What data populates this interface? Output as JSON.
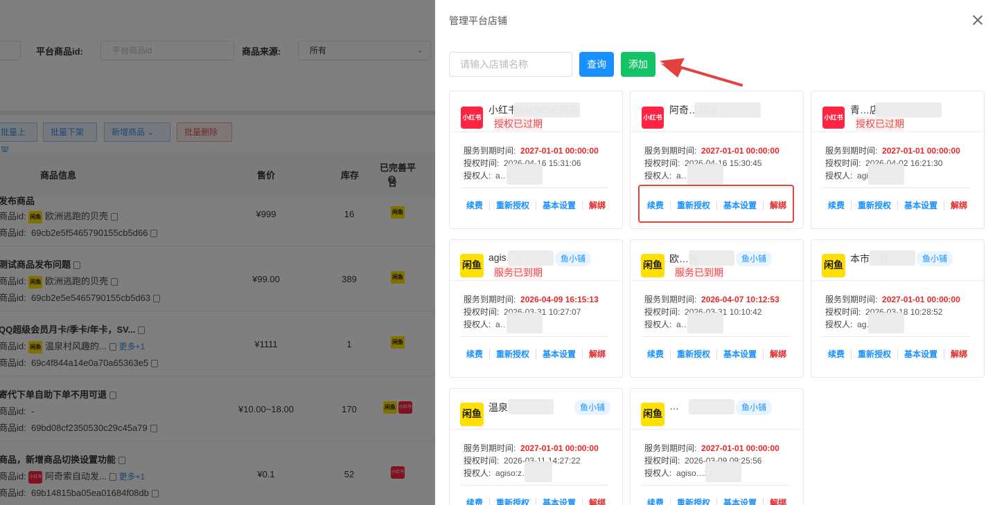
{
  "background": {
    "filters": {
      "platform_item_id_label": "平台商品id:",
      "platform_item_id_placeholder": "平台商品id",
      "source_label": "商品来源:",
      "source_value": "所有"
    },
    "bulk_buttons": [
      "批量上架",
      "批量下架",
      "新增商品",
      "批量删除"
    ],
    "columns": {
      "info": "商品信息",
      "price": "售价",
      "stock": "库存",
      "done": "已完善平",
      "done2": "台"
    },
    "rows": [
      {
        "title": "发布商品",
        "shop": "欧洲逃跑的贝壳",
        "item_id": "69cb2e5f5465790155cb5d66",
        "price": "¥999",
        "stock": "16"
      },
      {
        "title": "测试商品发布问题",
        "shop": "欧洲逃跑的贝壳",
        "item_id": "69cb2e5e5465790155cb5d63",
        "price": "¥99.00",
        "stock": "389"
      },
      {
        "title": "QQ超级会员月卡/季卡/年卡，SV...",
        "shop": "温泉村风趣的...",
        "more": "更多+1",
        "item_id": "69c4f844a14e0a70a65363e5",
        "price": "¥1111",
        "stock": "1"
      },
      {
        "title": "寄代下单自助下单不用可退",
        "shop": "-",
        "item_id": "69bd08cf2350530c29c45a79",
        "price": "¥10.00~18.00",
        "stock": "170"
      },
      {
        "title": "商品，新增商品切换设置功能",
        "shop": "阿奇索自动发...",
        "more": "更多+1",
        "item_id": "69b14815ba05ea01684f08db",
        "price": "¥0.1",
        "stock": "52"
      }
    ],
    "row_labels": {
      "prefix": "商品id:",
      "xianyu": "闲鱼",
      "xhs": "小红书"
    }
  },
  "drawer": {
    "title": "管理平台店铺",
    "search_placeholder": "请输入店铺名称",
    "query_label": "查询",
    "add_label": "添加",
    "labels": {
      "expire": "服务到期时间:",
      "auth_time": "授权时间:",
      "auth_user": "授权人:"
    },
    "actions": {
      "renew": "续费",
      "reauth": "重新授权",
      "settings": "基本设置",
      "unbind": "解绑"
    },
    "shops": [
      {
        "platform": "小红书",
        "name": "小红书64E9C9E的店",
        "status": "授权已过期",
        "tag": "",
        "expire": "2027-01-01 00:00:00",
        "auth_time": "2026-04-16 15:31:06",
        "auth_user": "a…k"
      },
      {
        "platform": "小红书",
        "name": "阿奇…的店",
        "status": "",
        "tag": "",
        "expire": "2027-01-01 00:00:00",
        "auth_time": "2026-04-16 15:30:45",
        "auth_user": "a…"
      },
      {
        "platform": "小红书",
        "name": "青…店",
        "status": "授权已过期",
        "tag": "",
        "expire": "2027-01-01 00:00:00",
        "auth_time": "2026-04-02 16:21:30",
        "auth_user": "agi…"
      },
      {
        "platform": "闲鱼",
        "name": "agis…3",
        "status": "服务已到期",
        "tag": "鱼小铺",
        "expire": "2026-04-09 16:15:13",
        "auth_time": "2026-03-31 10:27:07",
        "auth_user": "a…"
      },
      {
        "platform": "闲鱼",
        "name": "欧…壳",
        "status": "服务已到期",
        "tag": "鱼小铺",
        "expire": "2026-04-07 10:12:53",
        "auth_time": "2026-03-31 10:10:42",
        "auth_user": "a…"
      },
      {
        "platform": "闲鱼",
        "name": "本市…轻",
        "status": "",
        "tag": "鱼小铺",
        "expire": "2027-01-01 00:00:00",
        "auth_time": "2026-03-18 10:28:52",
        "auth_user": "ag…"
      },
      {
        "platform": "闲鱼",
        "name": "温泉…",
        "status": "",
        "tag": "鱼小铺",
        "expire": "2027-01-01 00:00:00",
        "auth_time": "2026-03-11 14:27:22",
        "auth_user": "agiso:z…"
      },
      {
        "platform": "闲鱼",
        "name": "…",
        "status": "",
        "tag": "鱼小铺",
        "expire": "2027-01-01 00:00:00",
        "auth_time": "2026-03-09 09:25:56",
        "auth_user": "agiso…zs"
      }
    ]
  },
  "colors": {
    "primary": "#1890ff",
    "success": "#13c467",
    "danger": "#e52727",
    "annotation": "#e3413d"
  }
}
